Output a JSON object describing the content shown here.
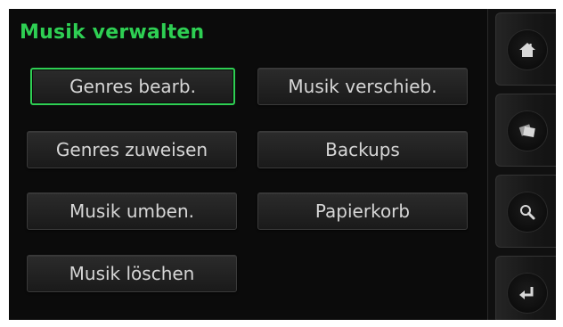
{
  "header": {
    "title": "Musik verwalten"
  },
  "buttons": {
    "edit_genres": "Genres bearb.",
    "assign_genres": "Genres zuweisen",
    "rename_music": "Musik umben.",
    "delete_music": "Musik löschen",
    "move_music": "Musik verschieb.",
    "backups": "Backups",
    "trash": "Papierkorb"
  },
  "sidebar": {
    "items": [
      {
        "icon": "home-icon"
      },
      {
        "icon": "albums-icon"
      },
      {
        "icon": "search-icon"
      },
      {
        "icon": "return-icon"
      }
    ]
  },
  "colors": {
    "accent": "#2ecf53",
    "background": "#0b0b0b",
    "button_text": "#d6d6d6"
  }
}
